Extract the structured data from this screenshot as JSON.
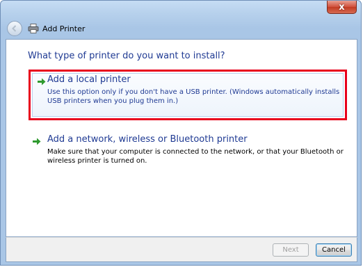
{
  "window": {
    "title": "Add Printer",
    "close_label": "x"
  },
  "main": {
    "question": "What type of printer do you want to install?",
    "options": [
      {
        "heading": "Add a local printer",
        "description": "Use this option only if you don't have a USB printer. (Windows automatically installs USB printers when you plug them in.)",
        "highlighted": true
      },
      {
        "heading": "Add a network, wireless or Bluetooth printer",
        "description": "Make sure that your computer is connected to the network, or that your Bluetooth or wireless printer is turned on.",
        "highlighted": false
      }
    ]
  },
  "footer": {
    "next_label": "Next",
    "cancel_label": "Cancel"
  },
  "colors": {
    "heading_text": "#1f3a93",
    "highlight_border": "#e8001c",
    "arrow_green": "#2f9a2f"
  },
  "icons": {
    "back": "back-arrow-icon",
    "printer": "printer-icon",
    "option_arrow": "green-arrow-icon"
  }
}
